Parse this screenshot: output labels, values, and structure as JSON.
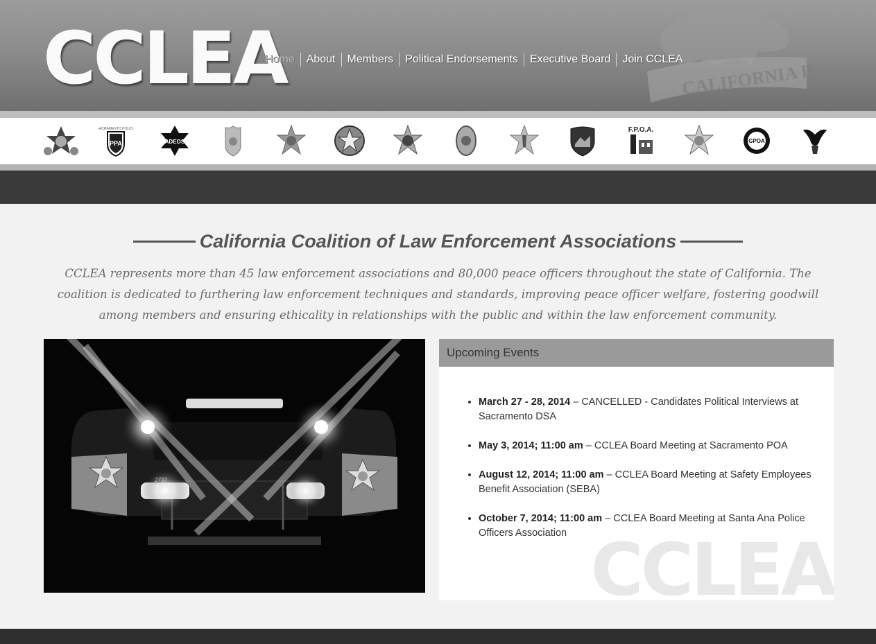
{
  "header": {
    "logo_text": "CCLEA",
    "nav": [
      {
        "label": "Home",
        "active": true
      },
      {
        "label": "About"
      },
      {
        "label": "Members"
      },
      {
        "label": "Political Endorsements"
      },
      {
        "label": "Executive Board"
      },
      {
        "label": "Join CCLEA"
      }
    ],
    "background_text": "CALIFORNIA REPUBLIC"
  },
  "member_logos": [
    {
      "icon": "star-badge-icon"
    },
    {
      "icon": "shield-badge-icon",
      "text": "PPA"
    },
    {
      "icon": "star-badge-icon",
      "text": "ADEOS"
    },
    {
      "icon": "police-badge-icon"
    },
    {
      "icon": "star-badge-icon"
    },
    {
      "icon": "round-star-badge-icon"
    },
    {
      "icon": "star-badge-icon"
    },
    {
      "icon": "oval-badge-icon"
    },
    {
      "icon": "star-badge-icon"
    },
    {
      "icon": "shield-badge-icon"
    },
    {
      "icon": "fpoa-logo-icon",
      "text": "F.P.O.A."
    },
    {
      "icon": "star-badge-icon"
    },
    {
      "icon": "circle-seal-icon",
      "text": "GPOA"
    },
    {
      "icon": "eagle-icon"
    }
  ],
  "main": {
    "title": "California Coalition of Law Enforcement Associations",
    "intro": "CCLEA represents more than 45 law enforcement associations and 80,000 peace officers throughout the state of California. The coalition is dedicated to furthering law enforcement techniques and standards, improving peace officer welfare, fostering goodwill among members and ensuring ethicality in relationships with the public and within the law enforcement community.",
    "photo": {
      "unit_number": "2737"
    }
  },
  "events": {
    "heading": "Upcoming Events",
    "watermark": "CCLEA",
    "items": [
      {
        "date": "March 27 - 28, 2014",
        "text": " – CANCELLED - Candidates Political Interviews at Sacramento DSA"
      },
      {
        "date": "May 3, 2014; 11:00 am",
        "text": " – CCLEA Board Meeting at Sacramento POA"
      },
      {
        "date": "August 12, 2014; 11:00 am",
        "text": " – CCLEA Board Meeting at Safety Employees Benefit Association (SEBA)"
      },
      {
        "date": "October 7, 2014; 11:00 am",
        "text": " – CCLEA Board Meeting at Santa Ana Police Officers Association"
      }
    ]
  },
  "colors": {
    "header_top": "#9c9c9c",
    "header_bottom": "#6f6f6f",
    "dark_band": "#3a3a3a",
    "page_bg": "#f2f2f2",
    "events_header": "#9a9a9a"
  }
}
